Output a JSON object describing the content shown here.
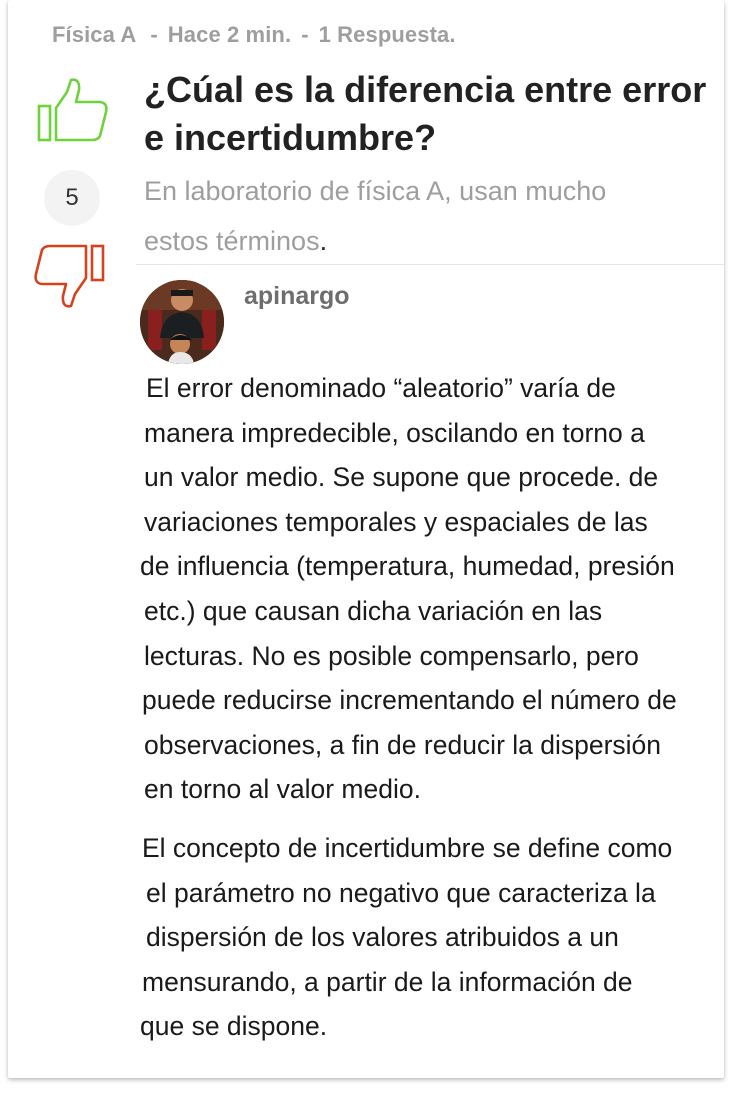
{
  "question": {
    "subject": "Física A",
    "time": "Hace 2 min.",
    "responses": "1 Respuesta.",
    "separator": "-",
    "title_lines": [
      "¿Cúal es la diferencia entre error",
      "e incertidumbre?"
    ],
    "description_lines": [
      "En laboratorio de física A, usan mucho",
      "estos términos"
    ],
    "description_end": ".",
    "votes": "5"
  },
  "vote_icons": {
    "upvote": "thumbs-up-icon",
    "downvote": "thumbs-down-icon",
    "upvote_color": "#6dd23c",
    "downvote_color": "#d4421e"
  },
  "answer": {
    "username": "apinargo",
    "paragraph1": [
      "El error denominado “aleatorio” varía de",
      "manera impredecible, oscilando en torno a",
      "un valor medio. Se supone que procede. de",
      "variaciones temporales y espaciales de las",
      "de influencia (temperatura, humedad, presión",
      "etc.) que causan dicha variación en las",
      "lecturas. No es posible compensarlo, pero",
      "puede reducirse incrementando el número de",
      "observaciones, a fin de reducir la dispersión",
      "en torno al valor medio."
    ],
    "paragraph2": [
      "El concepto de incertidumbre  se define como",
      "el parámetro no negativo que caracteriza la",
      "dispersión de los valores atribuidos a un",
      "mensurando, a partir de la información de",
      "que se dispone."
    ]
  }
}
